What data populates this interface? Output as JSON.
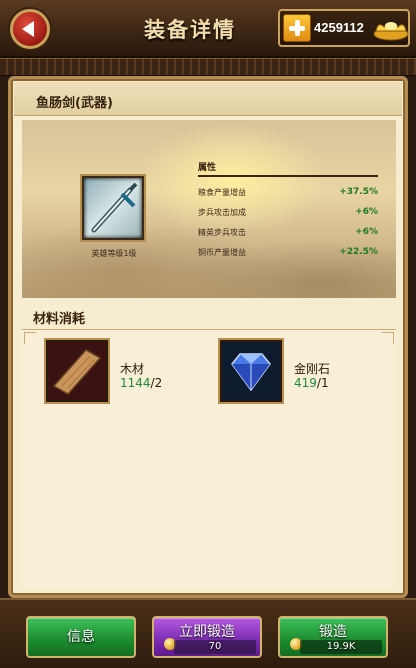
{
  "header": {
    "title": "装备详情",
    "gold_amount": "4259112"
  },
  "item": {
    "name": "鱼肠剑(武器)",
    "requirement": "英雄等级1级",
    "attributes_title": "属性",
    "attributes": [
      {
        "label": "粮食产量增益",
        "value": "+37.5%"
      },
      {
        "label": "步兵攻击加成",
        "value": "+6%"
      },
      {
        "label": "精英步兵攻击",
        "value": "+6%"
      },
      {
        "label": "铜币产量增益",
        "value": "+22.5%"
      }
    ]
  },
  "materials": {
    "title": "材料消耗",
    "items": [
      {
        "name": "木材",
        "have": "1144",
        "need": "/2"
      },
      {
        "name": "金刚石",
        "have": "419",
        "need": "/1"
      }
    ]
  },
  "buttons": {
    "info": "信息",
    "instant_forge": "立即锻造",
    "instant_forge_cost": "70",
    "forge": "锻造",
    "forge_cost": "19.9K"
  },
  "colors": {
    "have_count": "#1f8a3a",
    "attr_value": "#1f7a1f",
    "button_green": "#1b8a2e",
    "button_purple": "#7a2bb0"
  }
}
